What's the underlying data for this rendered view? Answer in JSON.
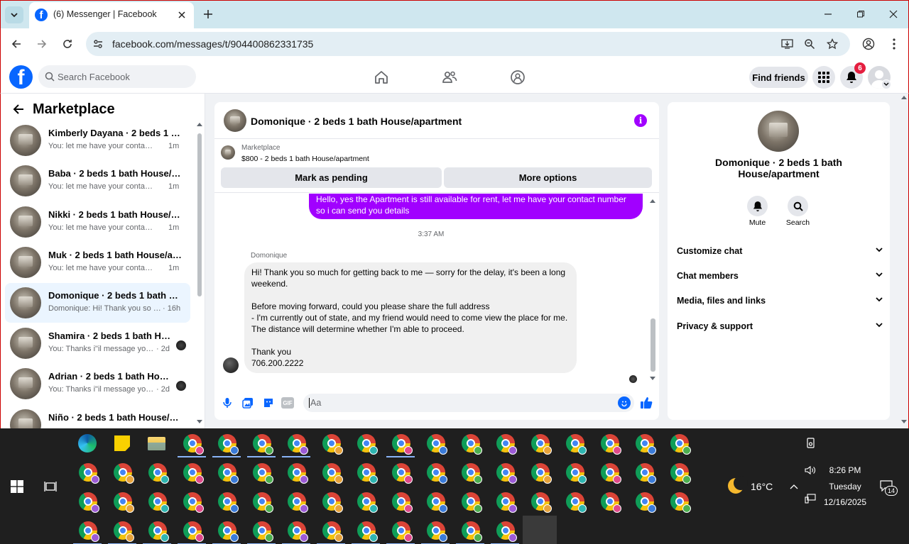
{
  "browser": {
    "tab_title": "(6) Messenger | Facebook",
    "url": "facebook.com/messages/t/904400862331735",
    "accent": "#cfe7ef"
  },
  "fb": {
    "search_placeholder": "Search Facebook",
    "find_friends": "Find friends",
    "notif_count": "6",
    "brand_color": "#0866ff"
  },
  "sidebar": {
    "title": "Marketplace",
    "conversations": [
      {
        "name": "Kimberly Dayana · 2 beds 1 bat...",
        "preview": "You: let me have your contact nu...",
        "time": "1m"
      },
      {
        "name": "Baba · 2 beds 1 bath House/apa...",
        "preview": "You: let me have your contact nu...",
        "time": "1m"
      },
      {
        "name": "Nikki · 2 beds 1 bath House/apa...",
        "preview": "You: let me have your contact nu...",
        "time": "1m"
      },
      {
        "name": "Muk · 2 beds 1 bath House/apar...",
        "preview": "You: let me have your contact nu...",
        "time": "1m"
      },
      {
        "name": "Domonique · 2 beds 1 bath Hou...",
        "preview": "Domonique: Hi! Thank you so mu...",
        "time": "· 16h"
      },
      {
        "name": "Shamira · 2 beds 1 bath Hous...",
        "preview": "You: Thanks i\"il message you in ...",
        "time": "· 2d"
      },
      {
        "name": "Adrian · 2 beds 1 bath House/...",
        "preview": "You: Thanks i\"il message you in ...",
        "time": "· 2d"
      },
      {
        "name": "Niño · 2 beds 1 bath House/apa...",
        "preview": "",
        "time": ""
      }
    ]
  },
  "chat": {
    "header_title": "Domonique · 2 beds 1 bath House/apartment",
    "listing_source": "Marketplace",
    "listing_title": "$800 - 2 beds 1 bath House/apartment",
    "mark_pending": "Mark as pending",
    "more_options": "More options",
    "outgoing_line1": "Hello, yes the Apartment is still available for rent, let me have your contact number",
    "outgoing_line2": "so i can send you details",
    "timestamp": "3:37 AM",
    "sender": "Domonique",
    "incoming": {
      "l1": "Hi! Thank you so much for getting back to me — sorry for the delay, it's been a long",
      "l2": "weekend.",
      "l3": "Before moving forward, could you please share the full address",
      "l4": "- I'm currently out of state, and my friend would need to come view the place for me.",
      "l5": "The distance will determine whether I'm able to proceed.",
      "l6": "Thank you",
      "l7": "706.200.2222"
    },
    "input_placeholder": "Aa",
    "accent": "#a100ff"
  },
  "info": {
    "name_line1": "Domonique · 2 beds 1 bath",
    "name_line2": "House/apartment",
    "mute": "Mute",
    "search": "Search",
    "sections": [
      "Customize chat",
      "Chat members",
      "Media, files and links",
      "Privacy & support"
    ]
  },
  "taskbar": {
    "weather": "16°C",
    "time": "8:26 PM",
    "day": "Tuesday",
    "date": "12/16/2025",
    "notif": "14"
  }
}
